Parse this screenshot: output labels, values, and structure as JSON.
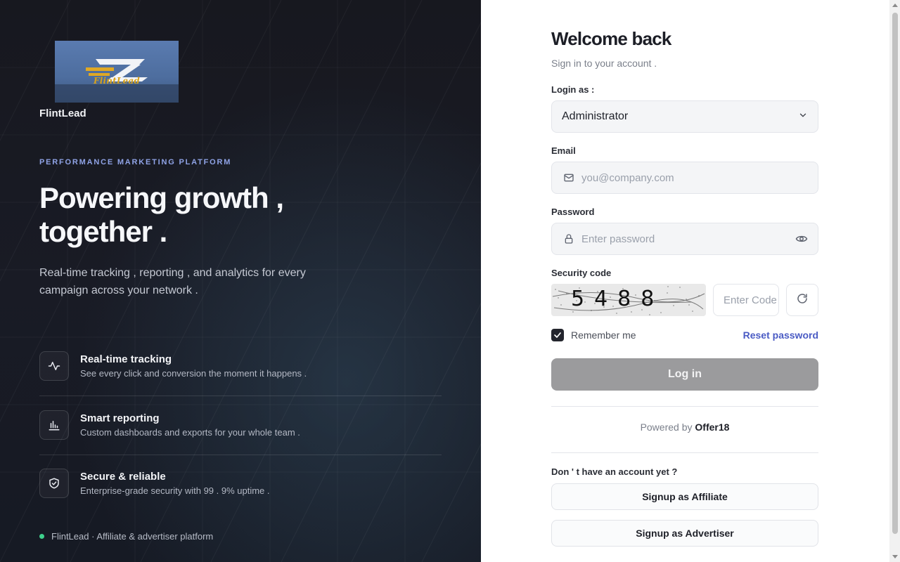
{
  "hero": {
    "logo_text": "FlintLead",
    "brand_name": "FlintLead",
    "eyebrow": "PERFORMANCE MARKETING PLATFORM",
    "headline_line1": "Powering growth ,",
    "headline_line2": "together .",
    "subtext": "Real-time tracking , reporting , and analytics for every campaign across your network .",
    "features": [
      {
        "icon": "activity-icon",
        "title": "Real-time tracking",
        "desc": "See every click and conversion the moment it happens ."
      },
      {
        "icon": "bar-chart-icon",
        "title": "Smart reporting",
        "desc": "Custom dashboards and exports for your whole team ."
      },
      {
        "icon": "shield-check-icon",
        "title": "Secure & reliable",
        "desc": "Enterprise-grade security with 99 . 9% uptime ."
      }
    ],
    "footer_note": "FlintLead · Affiliate & advertiser platform",
    "status_color": "#3ed08c"
  },
  "form": {
    "title": "Welcome back",
    "subtitle": "Sign in to your account .",
    "login_as_label": "Login as :",
    "login_as_value": "Administrator",
    "email_label": "Email",
    "email_placeholder": "you@company.com",
    "password_label": "Password",
    "password_placeholder": "Enter password",
    "security_label": "Security code",
    "captcha_text": "5488",
    "captcha_placeholder": "Enter Code",
    "remember_label": "Remember me",
    "remember_checked": true,
    "reset_link": "Reset password",
    "login_button": "Log in",
    "powered_prefix": "Powered by ",
    "powered_brand": "Offer18",
    "no_account": "Don ' t have an account yet ?",
    "signup_affiliate": "Signup as Affiliate",
    "signup_advertiser": "Signup as Advertiser"
  },
  "colors": {
    "accent_link": "#4a5bc4",
    "eyebrow": "#8fa3e6",
    "login_button_bg": "#9b9b9d"
  }
}
